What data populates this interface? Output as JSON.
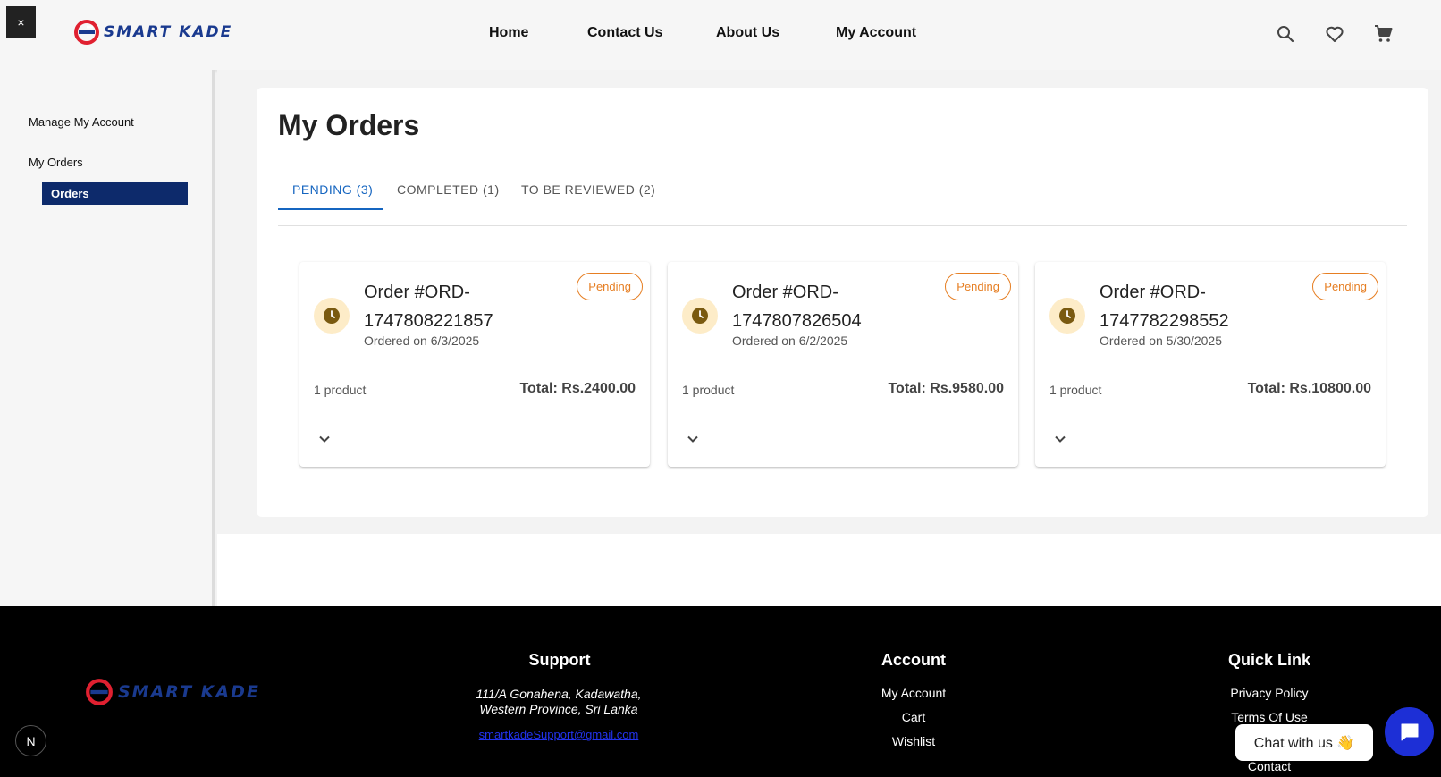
{
  "header": {
    "close_label": "×",
    "logo_text": "SMART KADE",
    "nav": [
      "Home",
      "Contact Us",
      "About Us",
      "My Account"
    ],
    "icons": [
      "search-icon",
      "heart-icon",
      "cart-icon"
    ]
  },
  "sidebar": {
    "manage_account": "Manage My Account",
    "my_orders": "My Orders",
    "orders": "Orders"
  },
  "main": {
    "title": "My Orders",
    "tabs": [
      "PENDING (3)",
      "COMPLETED (1)",
      "TO BE REVIEWED (2)"
    ],
    "orders": [
      {
        "title": "Order #ORD-1747808221857",
        "title_line1": "Order #ORD-",
        "title_line2": "1747808221857",
        "date": "Ordered on 6/3/2025",
        "status": "Pending",
        "products": "1 product",
        "total": "Total: Rs.2400.00"
      },
      {
        "title": "Order #ORD-1747807826504",
        "title_line1": "Order #ORD-",
        "title_line2": "1747807826504",
        "date": "Ordered on 6/2/2025",
        "status": "Pending",
        "products": "1 product",
        "total": "Total: Rs.9580.00"
      },
      {
        "title": "Order #ORD-1747782298552",
        "title_line1": "Order #ORD-",
        "title_line2": "1747782298552",
        "date": "Ordered on 5/30/2025",
        "status": "Pending",
        "products": "1 product",
        "total": "Total: Rs.10800.00"
      }
    ]
  },
  "footer": {
    "logo_text": "SMART KADE",
    "support": {
      "heading": "Support",
      "address_line1": "111/A Gonahena, Kadawatha,",
      "address_line2": "Western Province, Sri Lanka",
      "email": "smartkadeSupport@gmail.com"
    },
    "account": {
      "heading": "Account",
      "links": [
        "My Account",
        "Cart",
        "Wishlist"
      ]
    },
    "quick_link": {
      "heading": "Quick Link",
      "links": [
        "Privacy Policy",
        "Terms Of Use",
        "Contact"
      ]
    }
  },
  "chat": {
    "label": "Chat with us 👋"
  },
  "next_badge": "N",
  "colors": {
    "brand_navy": "#0d2a6b",
    "brand_red": "#e02030",
    "tab_active": "#1565c0",
    "pending": "#e67e22",
    "chat_button": "#1d2fd6"
  }
}
